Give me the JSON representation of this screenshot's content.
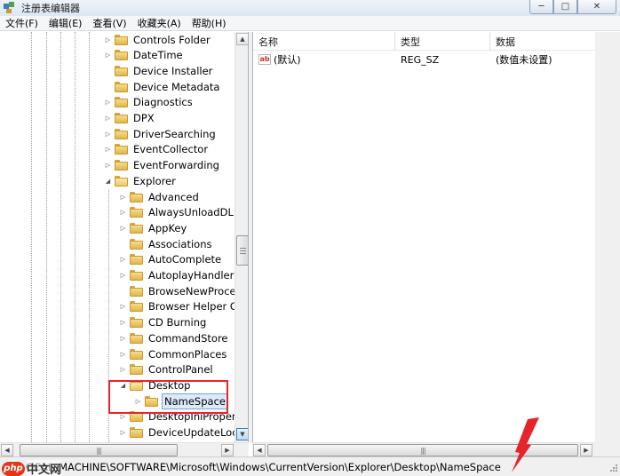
{
  "window": {
    "title": "注册表编辑器",
    "minimize_glyph": "─",
    "maximize_glyph": "□",
    "close_glyph": "✕"
  },
  "menu": [
    {
      "label": "文件(F)"
    },
    {
      "label": "编辑(E)"
    },
    {
      "label": "查看(V)"
    },
    {
      "label": "收藏夹(A)"
    },
    {
      "label": "帮助(H)"
    }
  ],
  "tree": {
    "items": [
      {
        "label": "Controls Folder",
        "level": 1,
        "expander": "▷"
      },
      {
        "label": "DateTime",
        "level": 1,
        "expander": "▷"
      },
      {
        "label": "Device Installer",
        "level": 1,
        "expander": ""
      },
      {
        "label": "Device Metadata",
        "level": 1,
        "expander": ""
      },
      {
        "label": "Diagnostics",
        "level": 1,
        "expander": "▷"
      },
      {
        "label": "DPX",
        "level": 1,
        "expander": "▷"
      },
      {
        "label": "DriverSearching",
        "level": 1,
        "expander": "▷"
      },
      {
        "label": "EventCollector",
        "level": 1,
        "expander": "▷"
      },
      {
        "label": "EventForwarding",
        "level": 1,
        "expander": "▷"
      },
      {
        "label": "Explorer",
        "level": 1,
        "expander": "◢"
      },
      {
        "label": "Advanced",
        "level": 2,
        "expander": "▷"
      },
      {
        "label": "AlwaysUnloadDLL",
        "level": 2,
        "expander": "▷"
      },
      {
        "label": "AppKey",
        "level": 2,
        "expander": "▷"
      },
      {
        "label": "Associations",
        "level": 2,
        "expander": ""
      },
      {
        "label": "AutoComplete",
        "level": 2,
        "expander": "▷"
      },
      {
        "label": "AutoplayHandlers",
        "level": 2,
        "expander": "▷"
      },
      {
        "label": "BrowseNewProcess",
        "level": 2,
        "expander": ""
      },
      {
        "label": "Browser Helper Obj",
        "level": 2,
        "expander": "▷"
      },
      {
        "label": "CD Burning",
        "level": 2,
        "expander": "▷"
      },
      {
        "label": "CommandStore",
        "level": 2,
        "expander": "▷"
      },
      {
        "label": "CommonPlaces",
        "level": 2,
        "expander": "▷"
      },
      {
        "label": "ControlPanel",
        "level": 2,
        "expander": "▷"
      },
      {
        "label": "Desktop",
        "level": 2,
        "expander": "◢"
      },
      {
        "label": "NameSpace",
        "level": 3,
        "expander": "▷",
        "selected": true
      },
      {
        "label": "DesktopIniProperty",
        "level": 2,
        "expander": "▷"
      },
      {
        "label": "DeviceUpdateLocati",
        "level": 2,
        "expander": "▷"
      }
    ]
  },
  "list": {
    "columns": [
      {
        "label": "名称"
      },
      {
        "label": "类型"
      },
      {
        "label": "数据"
      }
    ],
    "rows": [
      {
        "name": "(默认)",
        "type": "REG_SZ",
        "data": "(数值未设置)",
        "icon": "ab"
      }
    ]
  },
  "scroll": {
    "up_glyph": "▲",
    "down_glyph": "▼",
    "left_glyph": "◀",
    "right_glyph": "▶",
    "thumb_grip": "|||"
  },
  "status": {
    "path": "OCAL_MACHINE\\SOFTWARE\\Microsoft\\Windows\\CurrentVersion\\Explorer\\Desktop\\NameSpace"
  },
  "watermark": {
    "logo": "php",
    "text": "中文网"
  },
  "annotation": {
    "color": "#e6242b"
  }
}
